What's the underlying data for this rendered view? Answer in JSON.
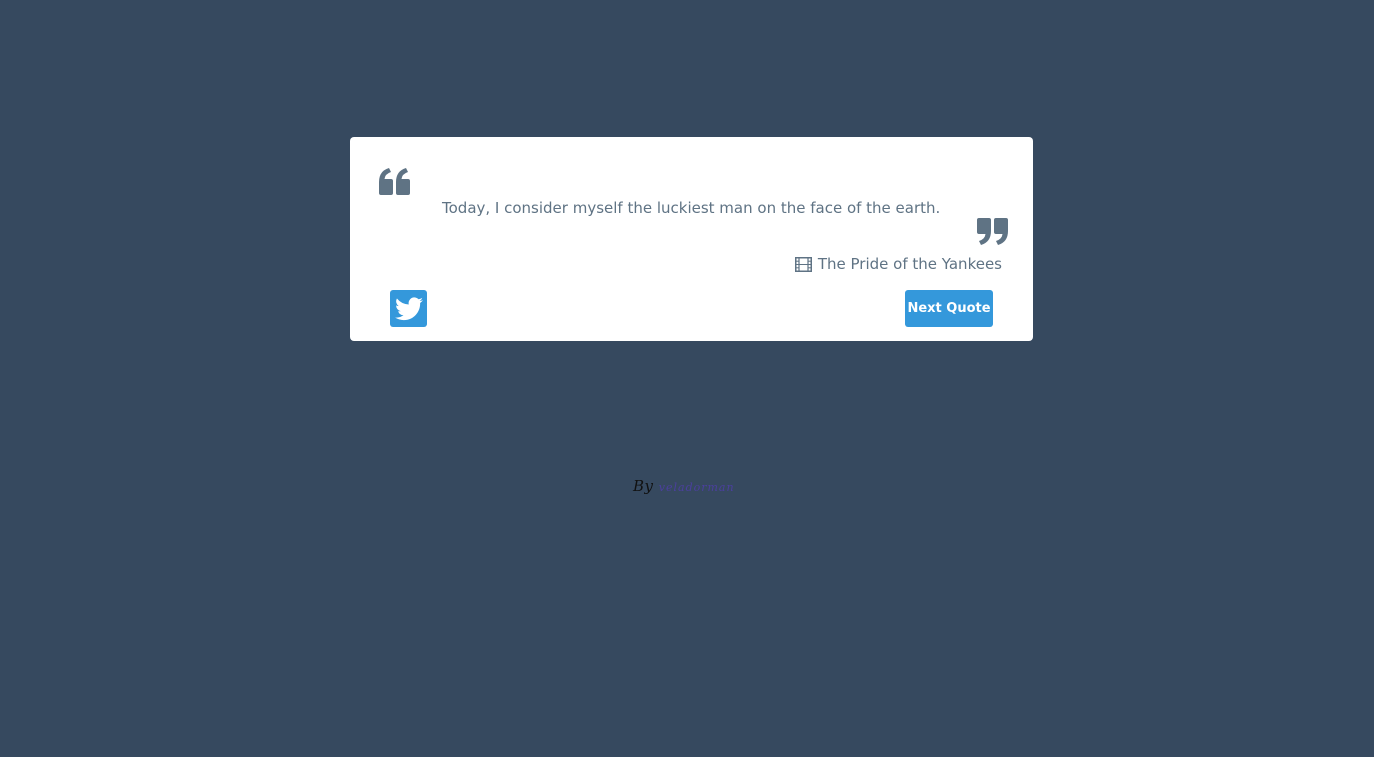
{
  "quote": {
    "text": "Today, I consider myself the luckiest man on the face of the earth.",
    "source": "The Pride of the Yankees",
    "open_icon": "quote-left-icon",
    "close_icon": "quote-right-icon",
    "source_icon": "film-icon"
  },
  "actions": {
    "tweet_icon": "twitter-icon",
    "next_label": "Next Quote"
  },
  "credit": {
    "prefix": "By",
    "author": "veladorman"
  },
  "colors": {
    "background": "#36495f",
    "card": "#ffffff",
    "accent": "#3498db",
    "text": "#5f7384"
  }
}
